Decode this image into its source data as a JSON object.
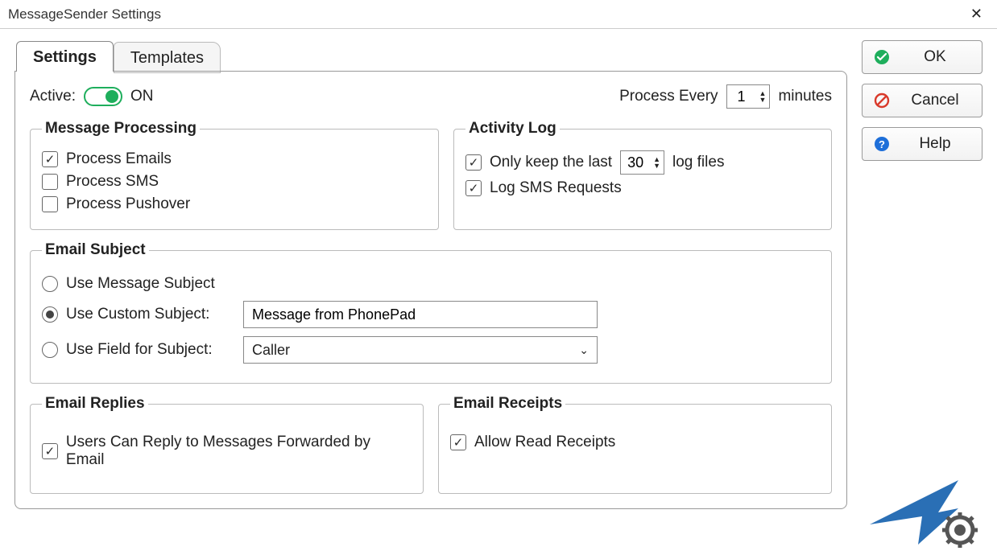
{
  "window": {
    "title": "MessageSender Settings"
  },
  "tabs": {
    "settings": "Settings",
    "templates": "Templates"
  },
  "buttons": {
    "ok": "OK",
    "cancel": "Cancel",
    "help": "Help"
  },
  "top": {
    "active_label": "Active:",
    "on_label": "ON",
    "process_every_label": "Process Every",
    "process_every_value": "1",
    "minutes_label": "minutes"
  },
  "message_processing": {
    "legend": "Message Processing",
    "emails": "Process Emails",
    "sms": "Process SMS",
    "pushover": "Process Pushover"
  },
  "activity_log": {
    "legend": "Activity Log",
    "keep_last_prefix": "Only keep the last",
    "keep_last_value": "30",
    "keep_last_suffix": "log files",
    "log_sms": "Log SMS Requests"
  },
  "email_subject": {
    "legend": "Email Subject",
    "use_msg": "Use Message Subject",
    "use_custom": "Use Custom Subject:",
    "custom_value": "Message from PhonePad",
    "use_field": "Use Field for Subject:",
    "field_value": "Caller"
  },
  "email_replies": {
    "legend": "Email Replies",
    "allow_reply": "Users Can Reply to Messages Forwarded by Email"
  },
  "email_receipts": {
    "legend": "Email Receipts",
    "allow_read": "Allow Read Receipts"
  }
}
